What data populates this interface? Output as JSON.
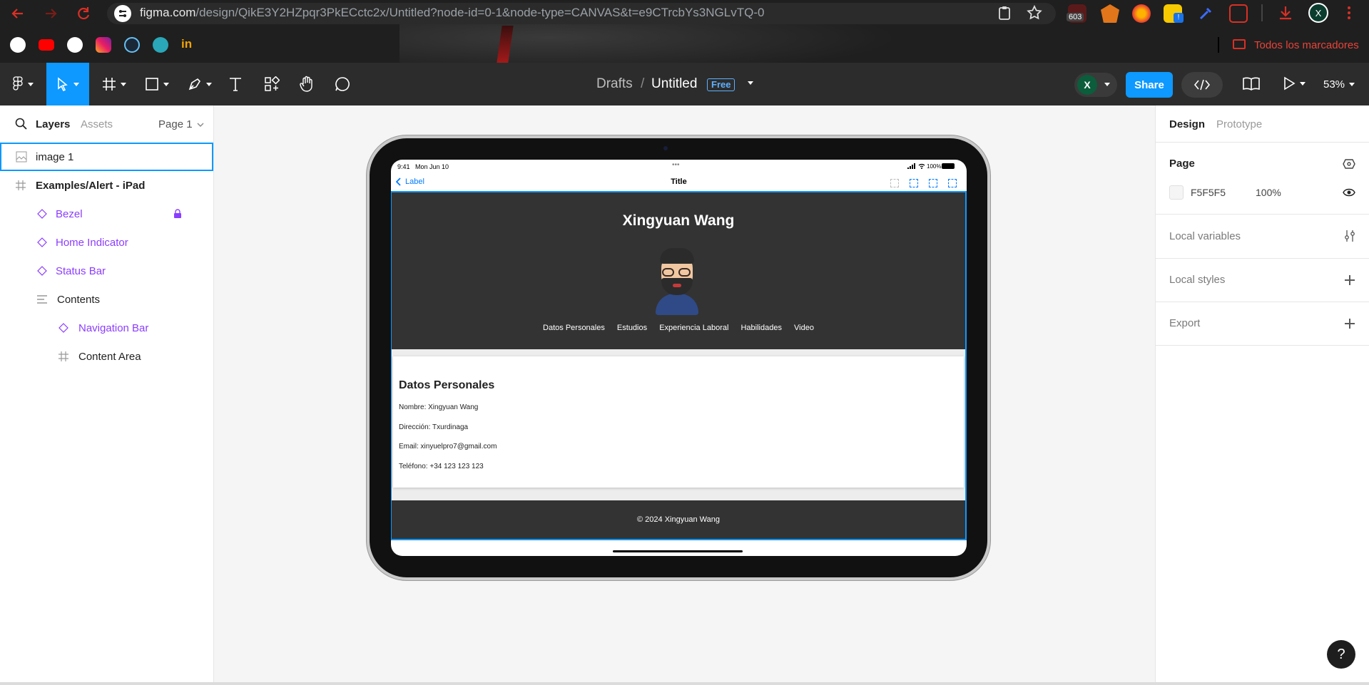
{
  "browser": {
    "url_host": "figma.com",
    "url_path": "/design/QikE3Y2HZpqr3PkECctc2x/Untitled?node-id=0-1&node-type=CANVAS&t=e9CTrcbYs3NGLvTQ-0",
    "extension_badge": "603",
    "profile_initial": "X",
    "bookmarks_label": "Todos los marcadores"
  },
  "toolbar": {
    "breadcrumb_root": "Drafts",
    "breadcrumb_sep": "/",
    "file_name": "Untitled",
    "plan_badge": "Free",
    "avatar_initial": "X",
    "share_label": "Share",
    "zoom": "53%"
  },
  "left_panel": {
    "tabs": [
      "Layers",
      "Assets"
    ],
    "page_selector": "Page 1",
    "layers": [
      {
        "label": "image 1",
        "type": "image"
      },
      {
        "label": "Examples/Alert - iPad",
        "type": "frame"
      },
      {
        "label": "Bezel",
        "type": "instance",
        "locked": true
      },
      {
        "label": "Home Indicator",
        "type": "instance"
      },
      {
        "label": "Status Bar",
        "type": "instance"
      },
      {
        "label": "Contents",
        "type": "autolayout"
      },
      {
        "label": "Navigation Bar",
        "type": "instance"
      },
      {
        "label": "Content Area",
        "type": "frame"
      }
    ]
  },
  "right_panel": {
    "tabs": [
      "Design",
      "Prototype"
    ],
    "page_section": "Page",
    "page_color": "F5F5F5",
    "page_opacity": "100%",
    "sections": [
      "Local variables",
      "Local styles",
      "Export"
    ]
  },
  "ipad": {
    "status_time": "9:41",
    "status_date": "Mon Jun 10",
    "status_dots": "•••",
    "battery": "100%",
    "nav_back": "Label",
    "nav_title": "Title",
    "site": {
      "name": "Xingyuan Wang",
      "nav": [
        "Datos Personales",
        "Estudios",
        "Experiencia Laboral",
        "Habilidades",
        "Video"
      ],
      "section_title": "Datos Personales",
      "lines": [
        "Nombre: Xingyuan Wang",
        "Dirección: Txurdinaga",
        "Email: xinyuelpro7@gmail.com",
        "Teléfono: +34 123 123 123"
      ],
      "footer": "© 2024 Xingyuan Wang"
    }
  },
  "colors": {
    "accent": "#0d99ff",
    "component_purple": "#8b3dff",
    "dark_bg": "#333333"
  },
  "help_label": "?"
}
